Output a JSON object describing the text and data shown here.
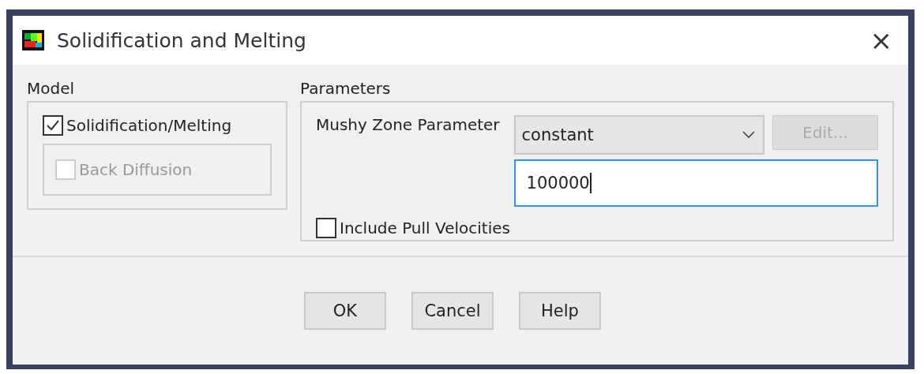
{
  "window": {
    "title": "Solidification and Melting",
    "close": "×"
  },
  "model": {
    "label": "Model",
    "solidification": {
      "label": "Solidification/Melting",
      "checked": true
    },
    "back_diffusion": {
      "label": "Back Diffusion",
      "checked": false,
      "disabled": true
    }
  },
  "parameters": {
    "label": "Parameters",
    "mushy_zone": {
      "label": "Mushy Zone Parameter",
      "method": "constant",
      "edit_button": {
        "label": "Edit...",
        "disabled": true
      },
      "value": "100000"
    },
    "pull_velocities": {
      "label": "Include Pull Velocities",
      "checked": false
    }
  },
  "buttons": [
    "OK",
    "Cancel",
    "Help"
  ]
}
